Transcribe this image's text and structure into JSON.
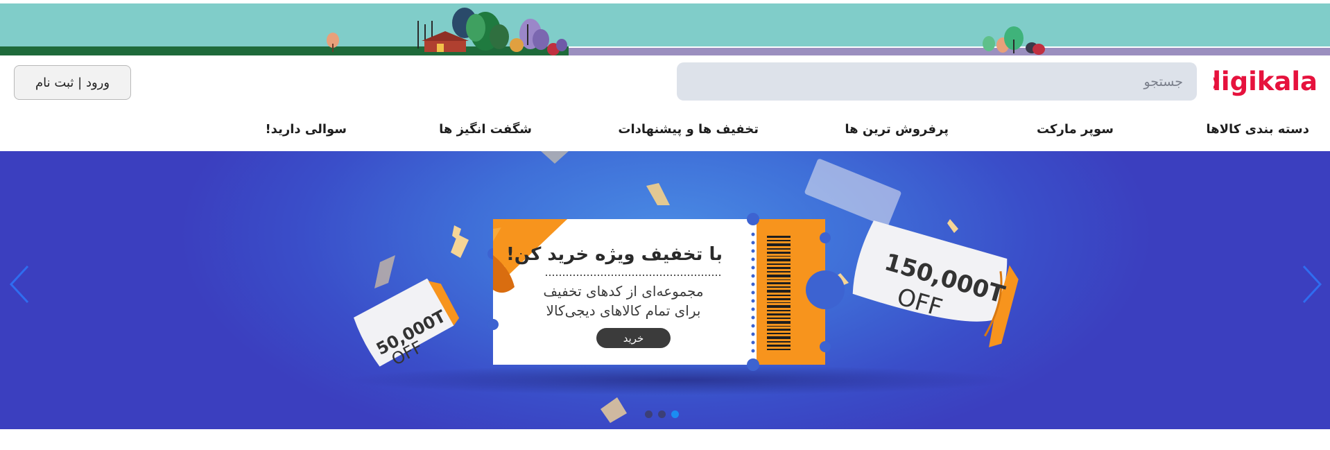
{
  "brand": {
    "logo_text": "digikala",
    "color": "#e6123d"
  },
  "search": {
    "placeholder": "جستجو",
    "value": ""
  },
  "account": {
    "login_label": "ورود | ثبت نام"
  },
  "nav": {
    "items": [
      {
        "label": "دسته بندی کالاها"
      },
      {
        "label": "سوپر مارکت"
      },
      {
        "label": "پرفروش ترین ها"
      },
      {
        "label": "تخفیف ها و پیشنهادات"
      },
      {
        "label": "شگفت انگیز ها"
      },
      {
        "label": "سوالی دارید!"
      }
    ]
  },
  "hero": {
    "title": "با تخفیف ویژه خرید کن!",
    "line1": "مجموعه‌ای از کدهای تخفیف",
    "line2": "برای تمام کالاهای دیجی‌کالا",
    "cta_label": "خرید",
    "tag_large": {
      "amount": "150,000T",
      "suffix": "OFF"
    },
    "tag_small": {
      "amount": "50,000T",
      "suffix": "OFF"
    },
    "slides": {
      "count": 3,
      "active_index": 2
    },
    "colors": {
      "accent_orange": "#f7941d",
      "ticket_white": "#ffffff",
      "active_dot": "#1b8cf2"
    }
  },
  "icons": {
    "prev": "chevron-left-icon",
    "next": "chevron-right-icon"
  }
}
